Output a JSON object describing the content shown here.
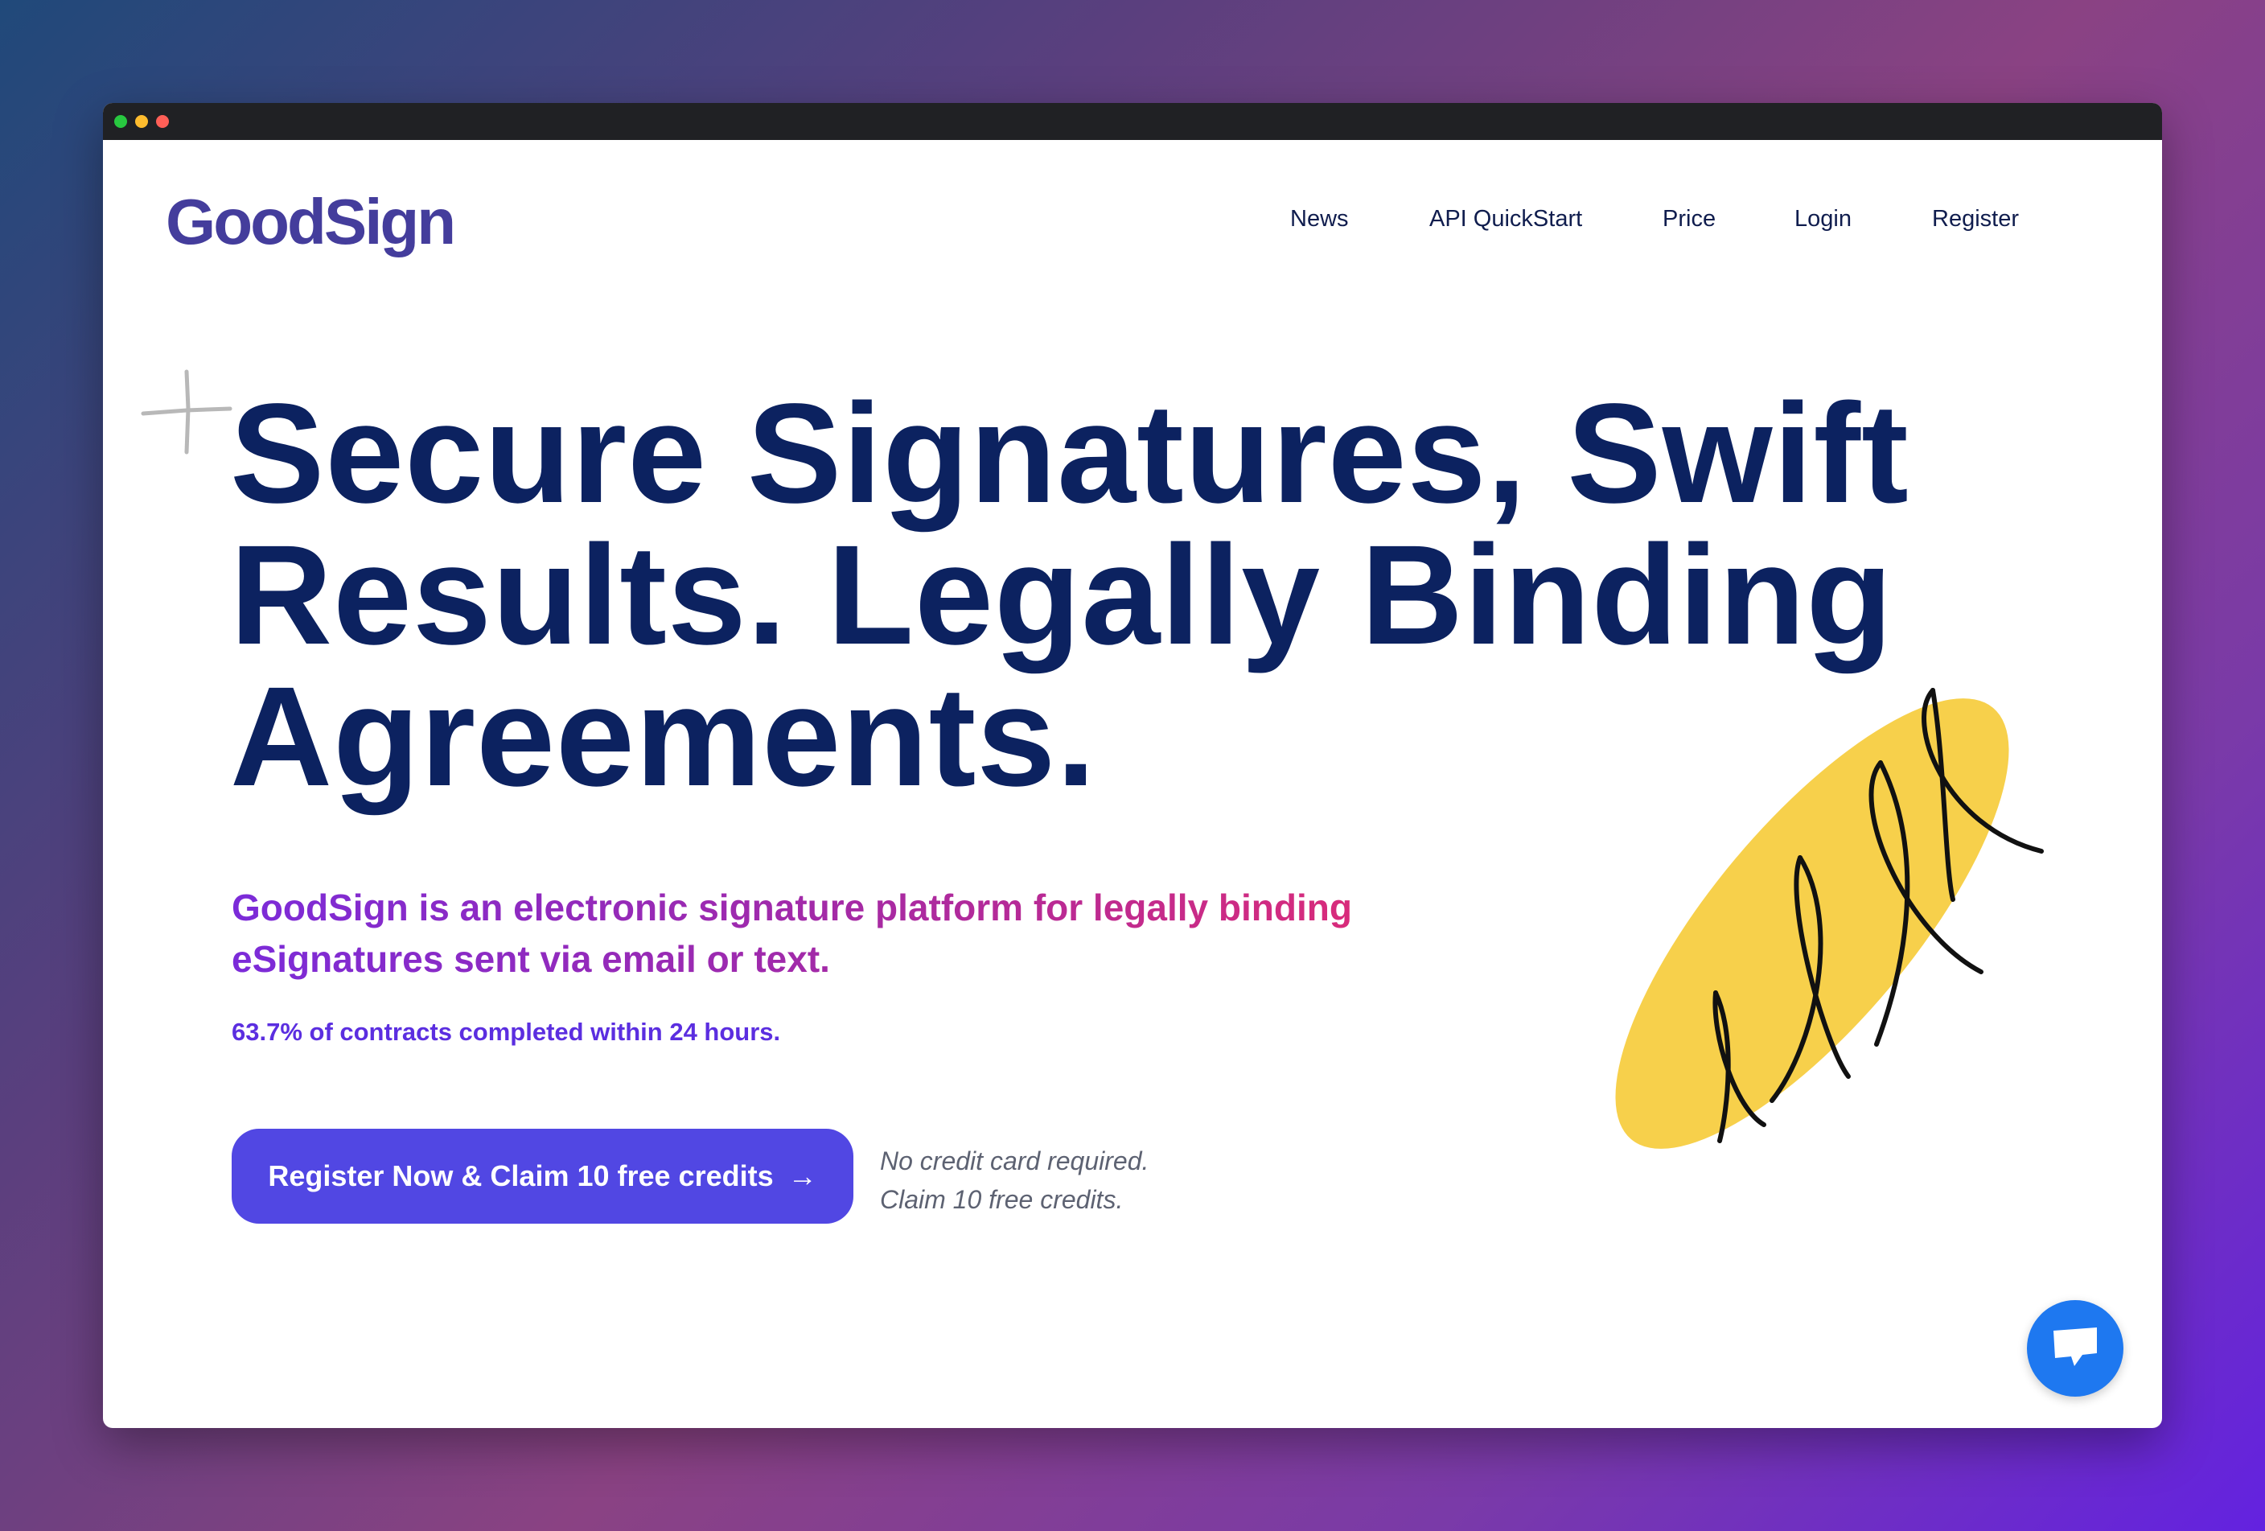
{
  "brand": {
    "logo_text": "GoodSign",
    "logo_color": "#443d9c"
  },
  "nav": {
    "items": [
      {
        "label": "News"
      },
      {
        "label": "API QuickStart"
      },
      {
        "label": "Price"
      },
      {
        "label": "Login"
      },
      {
        "label": "Register"
      }
    ]
  },
  "hero": {
    "headline": "Secure Signatures, Swift Results. Legally Binding Agreements.",
    "subtext": "GoodSign is an electronic signature platform for legally binding eSignatures sent via email or text.",
    "stat": "63.7% of contracts completed within 24 hours.",
    "cta_label": "Register Now & Claim 10 free credits",
    "cta_arrow": "→",
    "note_line1": "No credit card required.",
    "note_line2": "Claim 10 free credits."
  },
  "icons": {
    "chat": "chat-bubble-icon",
    "sparkle": "sparkle-icon",
    "decor": "yellow-scribble-oval"
  },
  "colors": {
    "headline": "#0c2260",
    "cta_background": "#5147e3",
    "stat": "#5b2ee0",
    "accent_yellow": "#f7d04b",
    "chat_button": "#1e78f0"
  }
}
